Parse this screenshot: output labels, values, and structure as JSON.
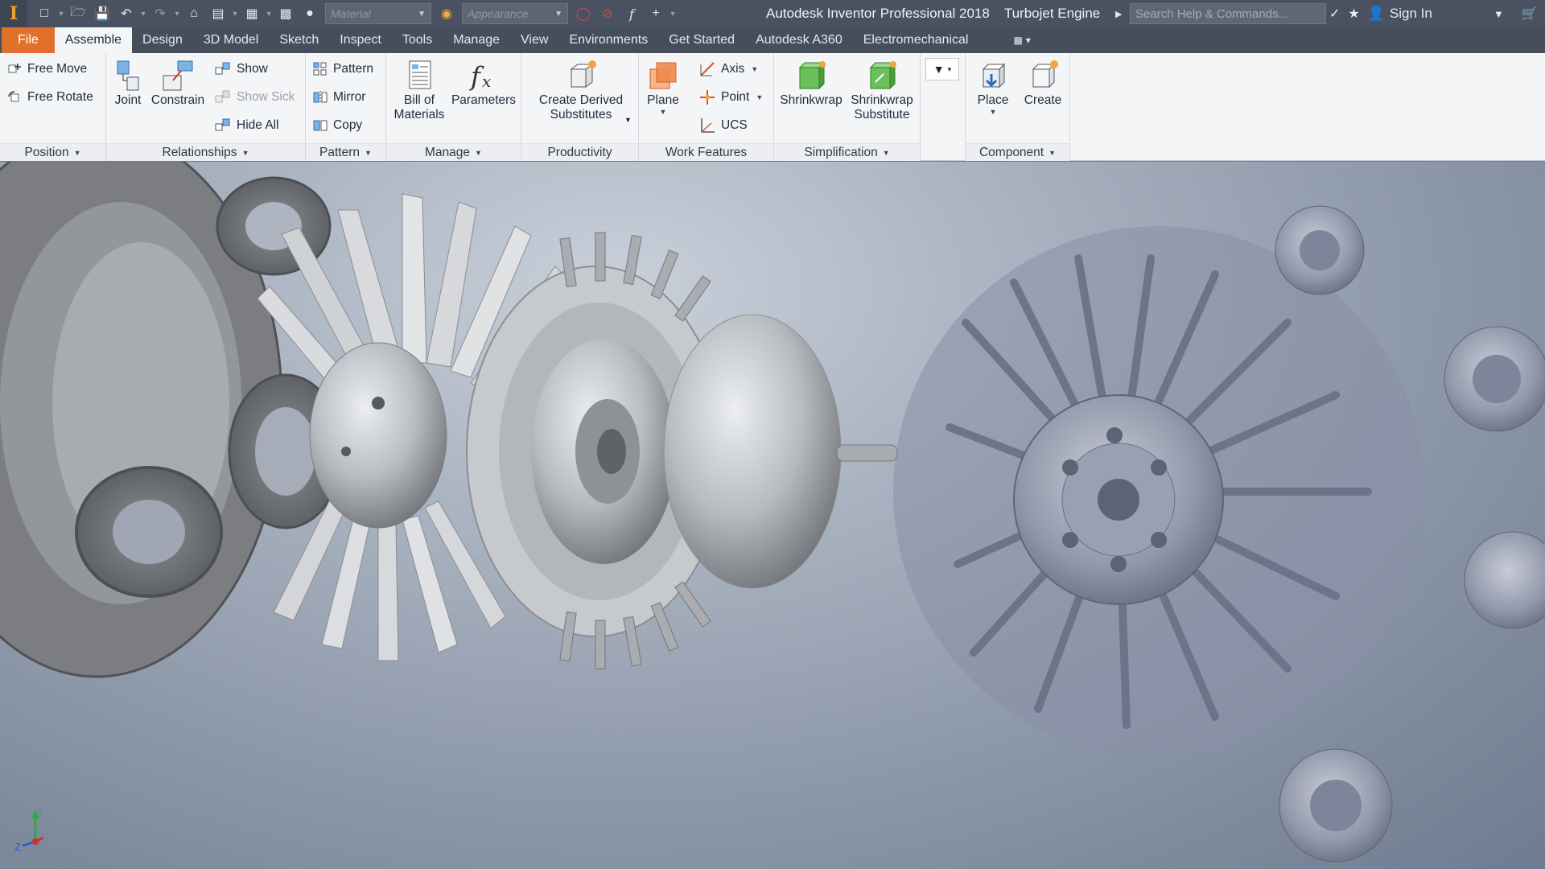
{
  "app": {
    "title": "Autodesk Inventor Professional 2018",
    "document": "Turbojet Engine",
    "logo_letter": "I",
    "accent": "#e1702b"
  },
  "quick_access": {
    "material_placeholder": "Material",
    "appearance_placeholder": "Appearance",
    "icons": [
      "new-icon",
      "open-icon",
      "save-icon",
      "undo-icon",
      "redo-icon",
      "home-icon",
      "update-icon",
      "select-icon",
      "material-icon",
      "appearance-icon",
      "clear-override-icon",
      "parameters-icon",
      "measure-icon",
      "customize-icon"
    ]
  },
  "search": {
    "placeholder": "Search Help & Commands..."
  },
  "account": {
    "sign_in": "Sign In"
  },
  "tabs": [
    {
      "label": "File"
    },
    {
      "label": "Assemble"
    },
    {
      "label": "Design"
    },
    {
      "label": "3D Model"
    },
    {
      "label": "Sketch"
    },
    {
      "label": "Inspect"
    },
    {
      "label": "Tools"
    },
    {
      "label": "Manage"
    },
    {
      "label": "View"
    },
    {
      "label": "Environments"
    },
    {
      "label": "Get Started"
    },
    {
      "label": "Autodesk A360"
    },
    {
      "label": "Electromechanical"
    }
  ],
  "active_tab": "Assemble",
  "ribbon": {
    "position": {
      "title": "Position",
      "free_move": "Free Move",
      "free_rotate": "Free Rotate"
    },
    "relationships": {
      "title": "Relationships",
      "joint": "Joint",
      "constrain": "Constrain",
      "show": "Show",
      "show_sick": "Show Sick",
      "hide_all": "Hide All"
    },
    "pattern": {
      "title": "Pattern",
      "pattern": "Pattern",
      "mirror": "Mirror",
      "copy": "Copy"
    },
    "manage": {
      "title": "Manage",
      "bom_line1": "Bill of",
      "bom_line2": "Materials",
      "parameters": "Parameters"
    },
    "productivity": {
      "title": "Productivity",
      "cds_line1": "Create Derived",
      "cds_line2": "Substitutes"
    },
    "work_features": {
      "title": "Work Features",
      "plane": "Plane",
      "axis": "Axis",
      "point": "Point",
      "ucs": "UCS"
    },
    "simplification": {
      "title": "Simplification",
      "shrinkwrap": "Shrinkwrap",
      "ss_line1": "Shrinkwrap",
      "ss_line2": "Substitute"
    },
    "component": {
      "title": "Component",
      "place": "Place",
      "create": "Create"
    }
  },
  "viewcube": {
    "z_label": "Z",
    "y_label": "Y"
  }
}
